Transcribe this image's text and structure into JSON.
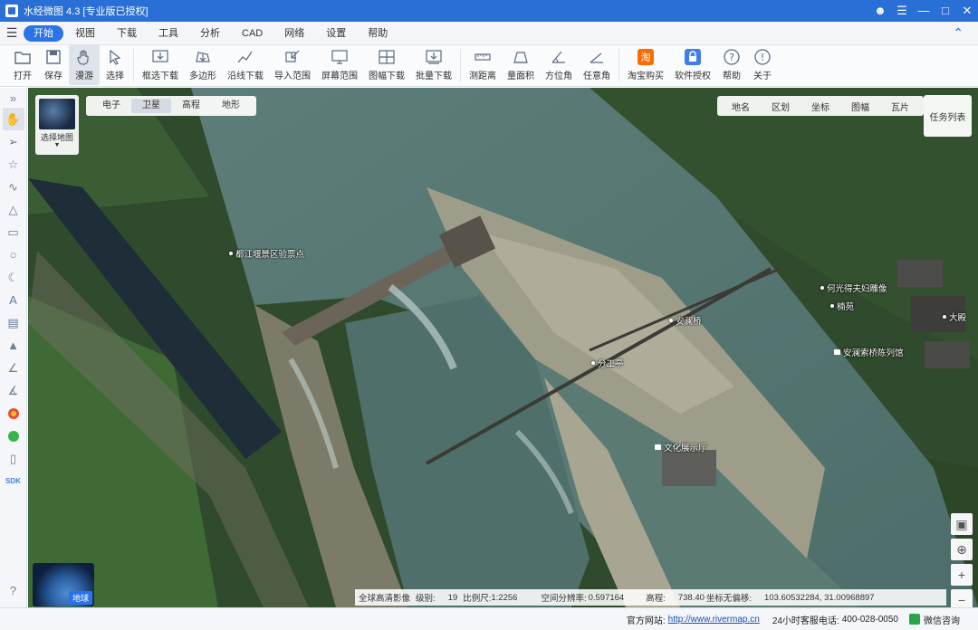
{
  "window": {
    "title": "水经微图 4.3 [专业版已授权]",
    "controls": [
      "user-icon",
      "menu-icon",
      "minimize-icon",
      "maximize-icon",
      "close-icon"
    ]
  },
  "menu": {
    "items": [
      "开始",
      "视图",
      "下载",
      "工具",
      "分析",
      "CAD",
      "网络",
      "设置",
      "帮助"
    ],
    "active": "开始"
  },
  "toolbar": {
    "items": [
      {
        "label": "打开",
        "icon": "folder-icon",
        "dropdown": true
      },
      {
        "label": "保存",
        "icon": "save-icon"
      },
      {
        "label": "漫游",
        "icon": "hand-icon",
        "active": true
      },
      {
        "label": "选择",
        "icon": "cursor-icon"
      },
      {
        "label": "框选下载",
        "icon": "box-download-icon"
      },
      {
        "label": "多边形",
        "icon": "polygon-icon"
      },
      {
        "label": "沿线下载",
        "icon": "polyline-download-icon"
      },
      {
        "label": "导入范围",
        "icon": "import-range-icon"
      },
      {
        "label": "屏幕范围",
        "icon": "screen-range-icon"
      },
      {
        "label": "图幅下载",
        "icon": "sheet-download-icon",
        "dropdown": true
      },
      {
        "label": "批量下载",
        "icon": "batch-download-icon"
      },
      {
        "label": "测距离",
        "icon": "ruler-icon"
      },
      {
        "label": "量面积",
        "icon": "area-icon"
      },
      {
        "label": "方位角",
        "icon": "azimuth-icon"
      },
      {
        "label": "任意角",
        "icon": "angle-icon"
      },
      {
        "label": "淘宝购买",
        "icon": "taobao-icon"
      },
      {
        "label": "软件授权",
        "icon": "license-icon"
      },
      {
        "label": "帮助",
        "icon": "help-icon"
      },
      {
        "label": "关于",
        "icon": "info-icon"
      }
    ]
  },
  "map_types": {
    "items": [
      "电子",
      "卫星",
      "高程",
      "地形"
    ],
    "active": "卫星"
  },
  "select_map_label": "选择地图",
  "right_tools": [
    "地名",
    "区划",
    "坐标",
    "图幅",
    "瓦片"
  ],
  "task_list_label": "任务列表",
  "pois": [
    {
      "name": "都江堰景区验票点",
      "kind": "dot"
    },
    {
      "name": "何光得夫妇雕像",
      "kind": "dot"
    },
    {
      "name": "楠苑",
      "kind": "dot"
    },
    {
      "name": "大殿",
      "kind": "dot"
    },
    {
      "name": "安澜索桥陈列馆",
      "kind": "pin"
    },
    {
      "name": "安澜桥",
      "kind": "dot"
    },
    {
      "name": "分工亭",
      "kind": "dot"
    },
    {
      "name": "文化展示厅",
      "kind": "pin"
    }
  ],
  "globe_label": "地球",
  "status": {
    "imagery": "全球高清影像",
    "level_label": "级别:",
    "level": "19",
    "scale_label": "比例尺:",
    "scale": "1:2256",
    "resolution_label": "空间分辨率:",
    "resolution": "0.597164",
    "elevation_label": "高程:",
    "elevation": "738.40",
    "coord_label": "坐标无偏移:",
    "coord": "103.60532284, 31.00968897"
  },
  "footer": {
    "site_label": "官方网站:",
    "site_url": "http://www.rivermap.cn",
    "hotline_label": "24小时客服电话:",
    "hotline": "400-028-0050",
    "wechat": "微信咨询"
  }
}
